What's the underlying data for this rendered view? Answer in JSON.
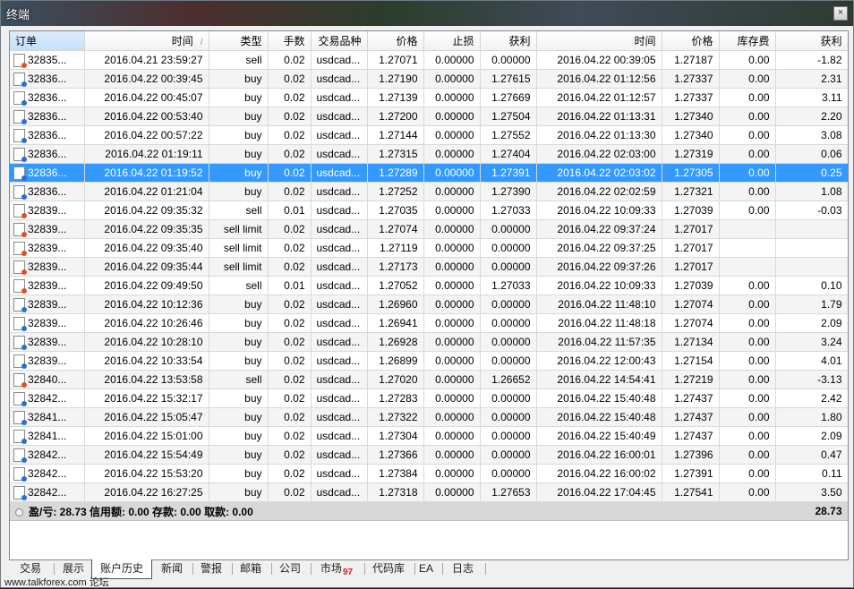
{
  "window": {
    "title": "终端",
    "close_glyph": "×"
  },
  "columns": [
    "订单",
    "时间",
    "类型",
    "手数",
    "交易品种",
    "价格",
    "止损",
    "获利",
    "时间",
    "价格",
    "库存费",
    "获利"
  ],
  "sort_indicator": "/",
  "rows": [
    {
      "order": "32835...",
      "open_time": "2016.04.21 23:59:27",
      "type": "sell",
      "lots": "0.02",
      "symbol": "usdcad...",
      "open_price": "1.27071",
      "sl": "0.00000",
      "tp": "0.00000",
      "close_time": "2016.04.22 00:39:05",
      "close_price": "1.27187",
      "swap": "0.00",
      "profit": "-1.82",
      "icon": "sell-order-icon"
    },
    {
      "order": "32836...",
      "open_time": "2016.04.22 00:39:45",
      "type": "buy",
      "lots": "0.02",
      "symbol": "usdcad...",
      "open_price": "1.27190",
      "sl": "0.00000",
      "tp": "1.27615",
      "close_time": "2016.04.22 01:12:56",
      "close_price": "1.27337",
      "swap": "0.00",
      "profit": "2.31",
      "icon": "buy-order-icon"
    },
    {
      "order": "32836...",
      "open_time": "2016.04.22 00:45:07",
      "type": "buy",
      "lots": "0.02",
      "symbol": "usdcad...",
      "open_price": "1.27139",
      "sl": "0.00000",
      "tp": "1.27669",
      "close_time": "2016.04.22 01:12:57",
      "close_price": "1.27337",
      "swap": "0.00",
      "profit": "3.11",
      "icon": "buy-order-icon"
    },
    {
      "order": "32836...",
      "open_time": "2016.04.22 00:53:40",
      "type": "buy",
      "lots": "0.02",
      "symbol": "usdcad...",
      "open_price": "1.27200",
      "sl": "0.00000",
      "tp": "1.27504",
      "close_time": "2016.04.22 01:13:31",
      "close_price": "1.27340",
      "swap": "0.00",
      "profit": "2.20",
      "icon": "buy-order-icon"
    },
    {
      "order": "32836...",
      "open_time": "2016.04.22 00:57:22",
      "type": "buy",
      "lots": "0.02",
      "symbol": "usdcad...",
      "open_price": "1.27144",
      "sl": "0.00000",
      "tp": "1.27552",
      "close_time": "2016.04.22 01:13:30",
      "close_price": "1.27340",
      "swap": "0.00",
      "profit": "3.08",
      "icon": "buy-order-icon"
    },
    {
      "order": "32836...",
      "open_time": "2016.04.22 01:19:11",
      "type": "buy",
      "lots": "0.02",
      "symbol": "usdcad...",
      "open_price": "1.27315",
      "sl": "0.00000",
      "tp": "1.27404",
      "close_time": "2016.04.22 02:03:00",
      "close_price": "1.27319",
      "swap": "0.00",
      "profit": "0.06",
      "icon": "buy-order-icon"
    },
    {
      "order": "32836...",
      "open_time": "2016.04.22 01:19:52",
      "type": "buy",
      "lots": "0.02",
      "symbol": "usdcad...",
      "open_price": "1.27289",
      "sl": "0.00000",
      "tp": "1.27391",
      "close_time": "2016.04.22 02:03:02",
      "close_price": "1.27305",
      "swap": "0.00",
      "profit": "0.25",
      "icon": "buy-order-icon",
      "selected": true
    },
    {
      "order": "32836...",
      "open_time": "2016.04.22 01:21:04",
      "type": "buy",
      "lots": "0.02",
      "symbol": "usdcad...",
      "open_price": "1.27252",
      "sl": "0.00000",
      "tp": "1.27390",
      "close_time": "2016.04.22 02:02:59",
      "close_price": "1.27321",
      "swap": "0.00",
      "profit": "1.08",
      "icon": "buy-order-icon"
    },
    {
      "order": "32839...",
      "open_time": "2016.04.22 09:35:32",
      "type": "sell",
      "lots": "0.01",
      "symbol": "usdcad...",
      "open_price": "1.27035",
      "sl": "0.00000",
      "tp": "1.27033",
      "close_time": "2016.04.22 10:09:33",
      "close_price": "1.27039",
      "swap": "0.00",
      "profit": "-0.03",
      "icon": "sell-order-icon"
    },
    {
      "order": "32839...",
      "open_time": "2016.04.22 09:35:35",
      "type": "sell limit",
      "lots": "0.02",
      "symbol": "usdcad...",
      "open_price": "1.27074",
      "sl": "0.00000",
      "tp": "0.00000",
      "close_time": "2016.04.22 09:37:24",
      "close_price": "1.27017",
      "swap": "",
      "profit": "",
      "icon": "sell-order-icon"
    },
    {
      "order": "32839...",
      "open_time": "2016.04.22 09:35:40",
      "type": "sell limit",
      "lots": "0.02",
      "symbol": "usdcad...",
      "open_price": "1.27119",
      "sl": "0.00000",
      "tp": "0.00000",
      "close_time": "2016.04.22 09:37:25",
      "close_price": "1.27017",
      "swap": "",
      "profit": "",
      "icon": "sell-order-icon"
    },
    {
      "order": "32839...",
      "open_time": "2016.04.22 09:35:44",
      "type": "sell limit",
      "lots": "0.02",
      "symbol": "usdcad...",
      "open_price": "1.27173",
      "sl": "0.00000",
      "tp": "0.00000",
      "close_time": "2016.04.22 09:37:26",
      "close_price": "1.27017",
      "swap": "",
      "profit": "",
      "icon": "sell-order-icon"
    },
    {
      "order": "32839...",
      "open_time": "2016.04.22 09:49:50",
      "type": "sell",
      "lots": "0.01",
      "symbol": "usdcad...",
      "open_price": "1.27052",
      "sl": "0.00000",
      "tp": "1.27033",
      "close_time": "2016.04.22 10:09:33",
      "close_price": "1.27039",
      "swap": "0.00",
      "profit": "0.10",
      "icon": "sell-order-icon"
    },
    {
      "order": "32839...",
      "open_time": "2016.04.22 10:12:36",
      "type": "buy",
      "lots": "0.02",
      "symbol": "usdcad...",
      "open_price": "1.26960",
      "sl": "0.00000",
      "tp": "0.00000",
      "close_time": "2016.04.22 11:48:10",
      "close_price": "1.27074",
      "swap": "0.00",
      "profit": "1.79",
      "icon": "buy-order-icon"
    },
    {
      "order": "32839...",
      "open_time": "2016.04.22 10:26:46",
      "type": "buy",
      "lots": "0.02",
      "symbol": "usdcad...",
      "open_price": "1.26941",
      "sl": "0.00000",
      "tp": "0.00000",
      "close_time": "2016.04.22 11:48:18",
      "close_price": "1.27074",
      "swap": "0.00",
      "profit": "2.09",
      "icon": "buy-order-icon"
    },
    {
      "order": "32839...",
      "open_time": "2016.04.22 10:28:10",
      "type": "buy",
      "lots": "0.02",
      "symbol": "usdcad...",
      "open_price": "1.26928",
      "sl": "0.00000",
      "tp": "0.00000",
      "close_time": "2016.04.22 11:57:35",
      "close_price": "1.27134",
      "swap": "0.00",
      "profit": "3.24",
      "icon": "buy-order-icon"
    },
    {
      "order": "32839...",
      "open_time": "2016.04.22 10:33:54",
      "type": "buy",
      "lots": "0.02",
      "symbol": "usdcad...",
      "open_price": "1.26899",
      "sl": "0.00000",
      "tp": "0.00000",
      "close_time": "2016.04.22 12:00:43",
      "close_price": "1.27154",
      "swap": "0.00",
      "profit": "4.01",
      "icon": "buy-order-icon"
    },
    {
      "order": "32840...",
      "open_time": "2016.04.22 13:53:58",
      "type": "sell",
      "lots": "0.02",
      "symbol": "usdcad...",
      "open_price": "1.27020",
      "sl": "0.00000",
      "tp": "1.26652",
      "close_time": "2016.04.22 14:54:41",
      "close_price": "1.27219",
      "swap": "0.00",
      "profit": "-3.13",
      "icon": "sell-order-icon"
    },
    {
      "order": "32842...",
      "open_time": "2016.04.22 15:32:17",
      "type": "buy",
      "lots": "0.02",
      "symbol": "usdcad...",
      "open_price": "1.27283",
      "sl": "0.00000",
      "tp": "0.00000",
      "close_time": "2016.04.22 15:40:48",
      "close_price": "1.27437",
      "swap": "0.00",
      "profit": "2.42",
      "icon": "buy-order-icon"
    },
    {
      "order": "32841...",
      "open_time": "2016.04.22 15:05:47",
      "type": "buy",
      "lots": "0.02",
      "symbol": "usdcad...",
      "open_price": "1.27322",
      "sl": "0.00000",
      "tp": "0.00000",
      "close_time": "2016.04.22 15:40:48",
      "close_price": "1.27437",
      "swap": "0.00",
      "profit": "1.80",
      "icon": "buy-order-icon"
    },
    {
      "order": "32841...",
      "open_time": "2016.04.22 15:01:00",
      "type": "buy",
      "lots": "0.02",
      "symbol": "usdcad...",
      "open_price": "1.27304",
      "sl": "0.00000",
      "tp": "0.00000",
      "close_time": "2016.04.22 15:40:49",
      "close_price": "1.27437",
      "swap": "0.00",
      "profit": "2.09",
      "icon": "buy-order-icon"
    },
    {
      "order": "32842...",
      "open_time": "2016.04.22 15:54:49",
      "type": "buy",
      "lots": "0.02",
      "symbol": "usdcad...",
      "open_price": "1.27366",
      "sl": "0.00000",
      "tp": "0.00000",
      "close_time": "2016.04.22 16:00:01",
      "close_price": "1.27396",
      "swap": "0.00",
      "profit": "0.47",
      "icon": "buy-order-icon"
    },
    {
      "order": "32842...",
      "open_time": "2016.04.22 15:53:20",
      "type": "buy",
      "lots": "0.02",
      "symbol": "usdcad...",
      "open_price": "1.27384",
      "sl": "0.00000",
      "tp": "0.00000",
      "close_time": "2016.04.22 16:00:02",
      "close_price": "1.27391",
      "swap": "0.00",
      "profit": "0.11",
      "icon": "buy-order-icon"
    },
    {
      "order": "32842...",
      "open_time": "2016.04.22 16:27:25",
      "type": "buy",
      "lots": "0.02",
      "symbol": "usdcad...",
      "open_price": "1.27318",
      "sl": "0.00000",
      "tp": "1.27653",
      "close_time": "2016.04.22 17:04:45",
      "close_price": "1.27541",
      "swap": "0.00",
      "profit": "3.50",
      "icon": "buy-order-icon"
    }
  ],
  "summary": {
    "text": "盈/亏: 28.73  信用额: 0.00  存款: 0.00  取款: 0.00",
    "total": "28.73"
  },
  "tabs": [
    {
      "label": "交易"
    },
    {
      "label": "展示"
    },
    {
      "label": "账户历史",
      "active": true
    },
    {
      "label": "新闻"
    },
    {
      "label": "警报"
    },
    {
      "label": "邮箱"
    },
    {
      "label": "公司"
    },
    {
      "label": "市场",
      "badge": "97"
    },
    {
      "label": "代码库"
    },
    {
      "label": "EA"
    },
    {
      "label": "日志"
    }
  ],
  "watermark": "www.talkforex.com 论坛",
  "colors": {
    "selection": "#3399ff",
    "header_active": "#c4e0fa",
    "summary_bg": "#d8d8d8",
    "badge": "#d82020"
  }
}
